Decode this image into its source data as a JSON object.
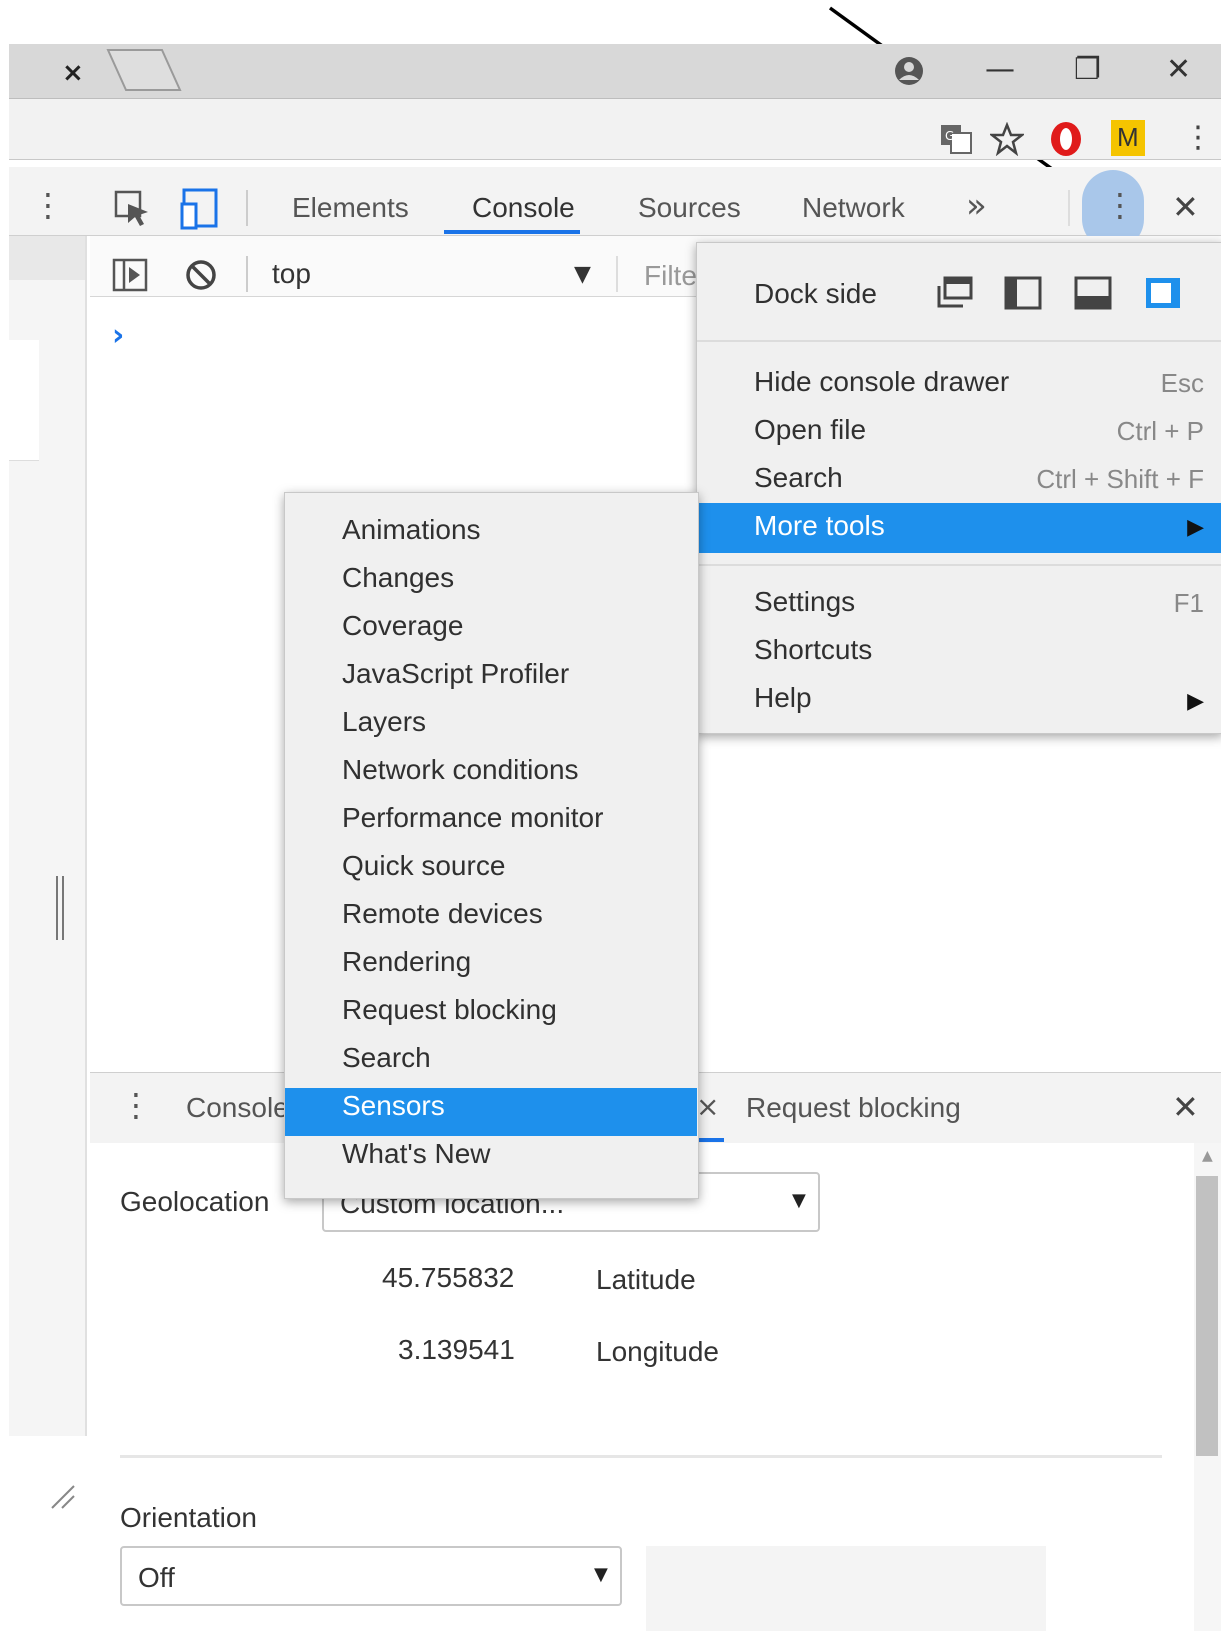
{
  "browser": {
    "tab_close": "×",
    "window_minimize": "—",
    "window_restore": "❐",
    "window_close": "✕",
    "ext_m_label": "M",
    "menu_dots": "⋮"
  },
  "devtools": {
    "tabs": [
      "Elements",
      "Console",
      "Sources",
      "Network"
    ],
    "more_tabs": "»",
    "close": "✕",
    "context_selector": "top",
    "filter_placeholder": "Filter",
    "prompt": "›"
  },
  "main_menu": {
    "dock_side_label": "Dock side",
    "items": [
      {
        "label": "Hide console drawer",
        "shortcut": "Esc"
      },
      {
        "label": "Open file",
        "shortcut": "Ctrl + P"
      },
      {
        "label": "Search",
        "shortcut": "Ctrl + Shift + F"
      },
      {
        "label": "More tools",
        "shortcut": "▶"
      },
      {
        "label": "Settings",
        "shortcut": "F1"
      },
      {
        "label": "Shortcuts",
        "shortcut": ""
      },
      {
        "label": "Help",
        "shortcut": "▶"
      }
    ]
  },
  "more_tools_menu": {
    "items": [
      "Animations",
      "Changes",
      "Coverage",
      "JavaScript Profiler",
      "Layers",
      "Network conditions",
      "Performance monitor",
      "Quick source",
      "Remote devices",
      "Rendering",
      "Request blocking",
      "Search",
      "Sensors",
      "What's New"
    ],
    "selected": "Sensors"
  },
  "drawer": {
    "tab_console": "Console",
    "tab_request_blocking": "Request blocking",
    "close": "✕",
    "tab_partial_close": "×"
  },
  "sensors": {
    "geolocation_label": "Geolocation",
    "geolocation_value": "Custom location...",
    "latitude_value": "45.755832",
    "latitude_label": "Latitude",
    "longitude_value": "3.139541",
    "longitude_label": "Longitude",
    "orientation_label": "Orientation",
    "orientation_value": "Off"
  },
  "colors": {
    "highlight": "#1e90ec",
    "menu_bg": "#f0f0f0",
    "accent_blue": "#1a73e8"
  }
}
